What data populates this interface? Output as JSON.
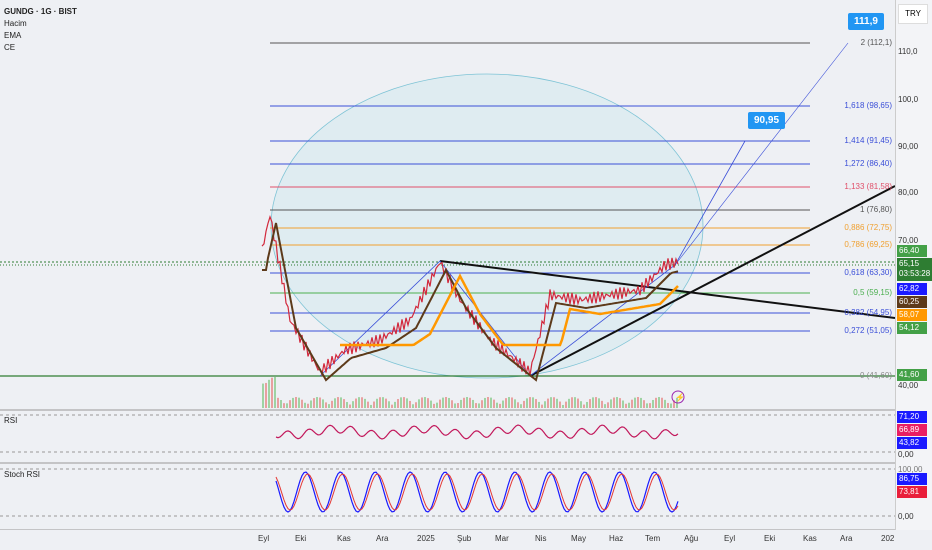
{
  "header": {
    "symbol": "GUNDG · 1G · BIST",
    "indicators": [
      "Hacim",
      "EMA",
      "CE"
    ],
    "currency": "TRY"
  },
  "price_axis": [
    "110,0",
    "100,0",
    "90,00",
    "80,00",
    "70,00",
    "40,00"
  ],
  "fib_levels": [
    {
      "label": "2 (112,1)",
      "color": "#555555"
    },
    {
      "label": "1,618 (98,65)",
      "color": "#3b4fd8"
    },
    {
      "label": "1,414 (91,45)",
      "color": "#3b4fd8"
    },
    {
      "label": "1,272 (86,40)",
      "color": "#3b4fd8"
    },
    {
      "label": "1,133 (81,58)",
      "color": "#e0506a"
    },
    {
      "label": "1 (76,80)",
      "color": "#555555"
    },
    {
      "label": "0,886 (72,75)",
      "color": "#f0a030"
    },
    {
      "label": "0,786 (69,25)",
      "color": "#f0a030"
    },
    {
      "label": "0,618 (63,30)",
      "color": "#3b4fd8"
    },
    {
      "label": "0,5 (59,15)",
      "color": "#4caf50"
    },
    {
      "label": "0,382 (54,95)",
      "color": "#3b4fd8"
    },
    {
      "label": "0,272 (51,05)",
      "color": "#3b4fd8"
    },
    {
      "label": "0 (41,60)",
      "color": "#888888"
    }
  ],
  "price_tags": [
    {
      "value": "66,40",
      "color": "#43a047"
    },
    {
      "value": "65,15",
      "sub": "03:53:28",
      "color": "#2e7d32"
    },
    {
      "value": "62,82",
      "color": "#1a1aff"
    },
    {
      "value": "60,25",
      "color": "#5d3a1a"
    },
    {
      "value": "58,07",
      "color": "#ff9800"
    },
    {
      "value": "54,12",
      "color": "#43a047"
    },
    {
      "value": "41,60",
      "color": "#43a047"
    }
  ],
  "callouts": [
    "111,9",
    "90,95"
  ],
  "rsi": {
    "label": "RSI",
    "tags": [
      {
        "value": "71,20",
        "color": "#1a1aff"
      },
      {
        "value": "66,89",
        "color": "#e91e63"
      },
      {
        "value": "43,82",
        "color": "#1a1aff"
      }
    ],
    "axis": "0,00"
  },
  "stoch": {
    "label": "Stoch RSI",
    "tags": [
      {
        "value": "86,75",
        "color": "#1a1aff"
      },
      {
        "value": "73,81",
        "color": "#e91e3a"
      }
    ],
    "axis_top": "100,00",
    "axis": "0,00"
  },
  "time_axis": [
    "Eyl",
    "Eki",
    "Kas",
    "Ara",
    "2025",
    "Şub",
    "Mar",
    "Nis",
    "May",
    "Haz",
    "Tem",
    "Ağu",
    "Eyl",
    "Eki",
    "Kas",
    "Ara",
    "202"
  ]
}
